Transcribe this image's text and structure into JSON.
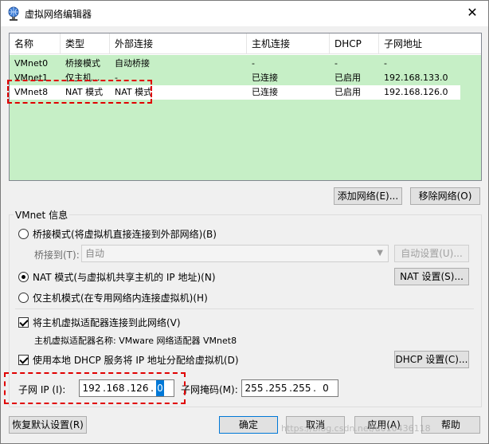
{
  "window": {
    "title": "虚拟网络编辑器",
    "close_glyph": "✕"
  },
  "table": {
    "columns": [
      "名称",
      "类型",
      "外部连接",
      "主机连接",
      "DHCP",
      "子网地址"
    ],
    "rows": [
      {
        "name": "VMnet0",
        "type": "桥接模式",
        "external": "自动桥接",
        "host": "-",
        "dhcp": "-",
        "subnet": "-"
      },
      {
        "name": "VMnet1",
        "type": "仅主机...",
        "external": "-",
        "host": "已连接",
        "dhcp": "已启用",
        "subnet": "192.168.133.0"
      },
      {
        "name": "VMnet8",
        "type": "NAT 模式",
        "external": "NAT 模式",
        "host": "已连接",
        "dhcp": "已启用",
        "subnet": "192.168.126.0"
      }
    ],
    "selected_row": 2
  },
  "list_buttons": {
    "add": "添加网络(E)...",
    "remove": "移除网络(O)"
  },
  "info": {
    "group_title": "VMnet 信息",
    "bridge_mode": "桥接模式(将虚拟机直接连接到外部网络)(B)",
    "bridge_to_label": "桥接到(T):",
    "bridge_to_value": "自动",
    "auto_settings": "自动设置(U)...",
    "nat_mode": "NAT 模式(与虚拟机共享主机的 IP 地址)(N)",
    "nat_settings": "NAT 设置(S)...",
    "host_only_mode": "仅主机模式(在专用网络内连接虚拟机)(H)",
    "connect_adapter": "将主机虚拟适配器连接到此网络(V)",
    "adapter_name": "主机虚拟适配器名称: VMware 网络适配器 VMnet8",
    "use_dhcp": "使用本地 DHCP 服务将 IP 地址分配给虚拟机(D)",
    "dhcp_settings": "DHCP 设置(C)...",
    "subnet_ip_label": "子网 IP (I):",
    "subnet_ip": [
      "192",
      "168",
      "126",
      "0"
    ],
    "subnet_mask_label": "子网掩码(M):",
    "subnet_mask": [
      "255",
      "255",
      "255",
      "0"
    ],
    "dot": "."
  },
  "footer": {
    "restore": "恢复默认设置(R)",
    "ok": "确定",
    "cancel": "取消",
    "apply": "应用(A)",
    "help": "帮助"
  },
  "watermark": "https://blog.csdn.net/u010436118",
  "colors": {
    "list_bg": "#c6efc6",
    "accent": "#0078d7",
    "annotation": "#e00000"
  }
}
